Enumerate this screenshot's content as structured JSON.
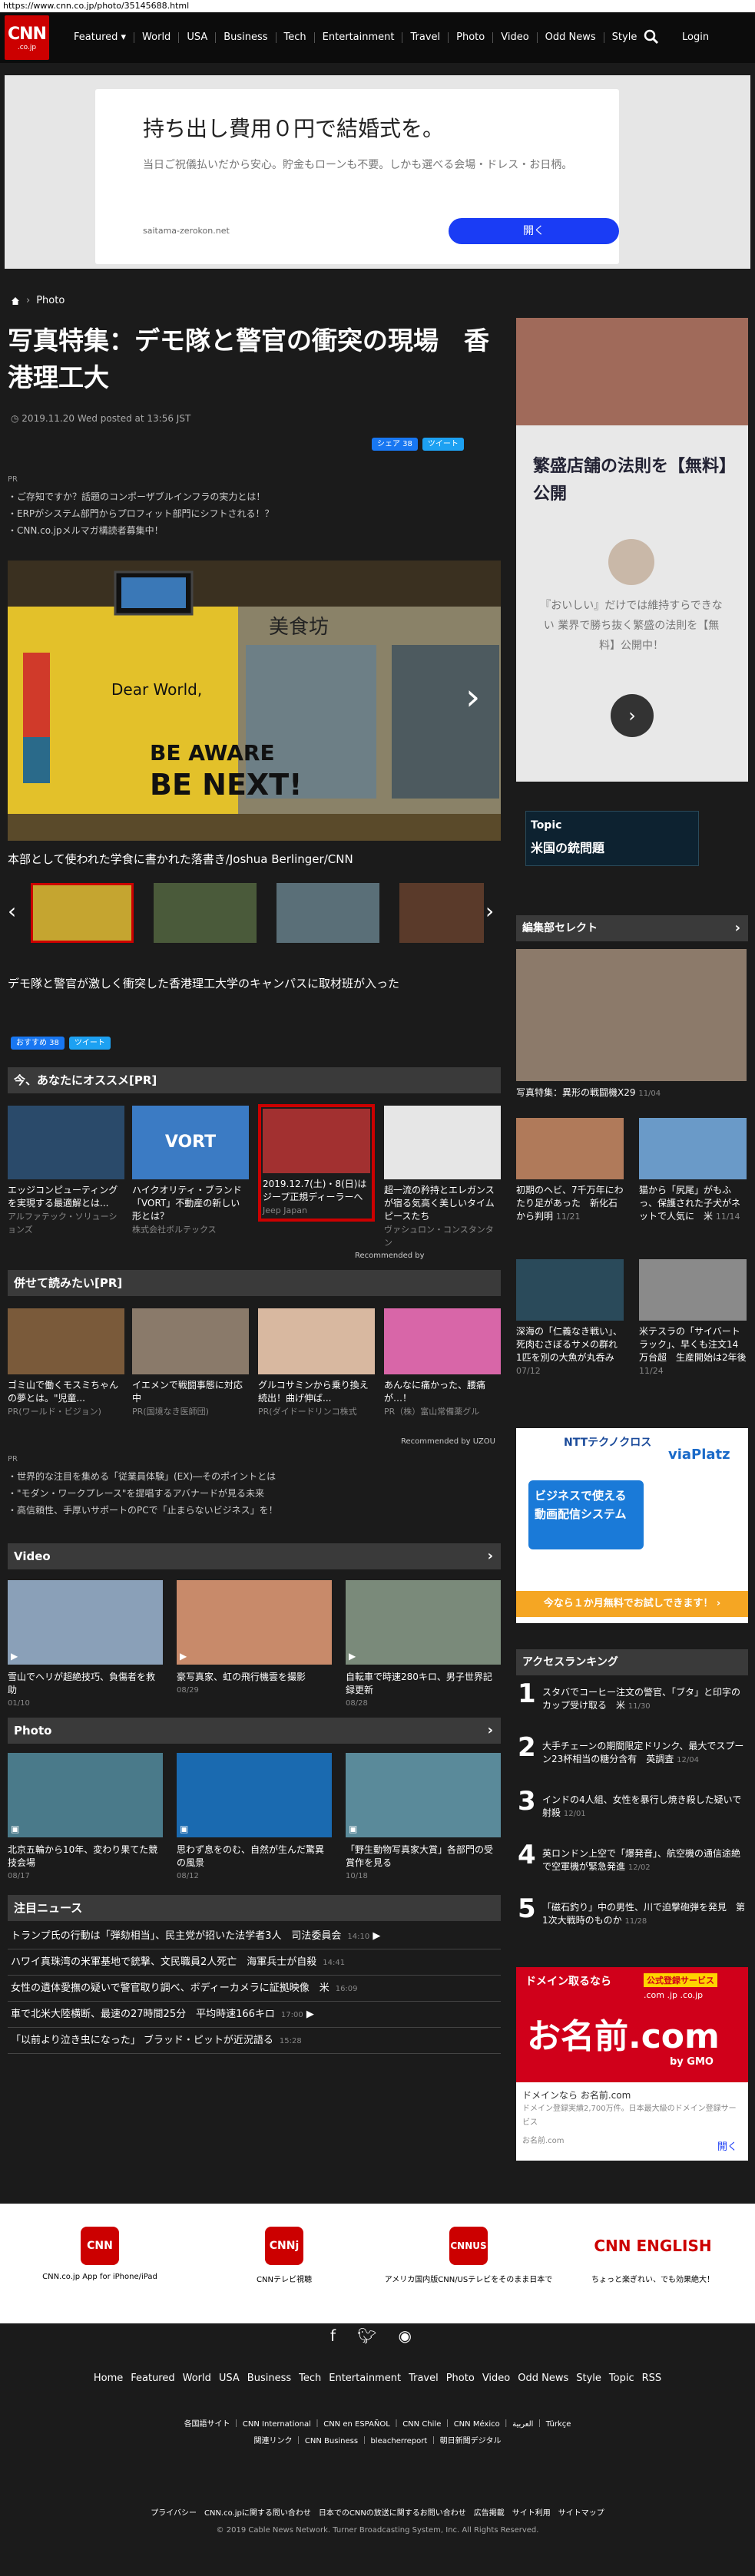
{
  "browser": {
    "url": "https://www.cnn.co.jp/photo/35145688.html"
  },
  "header": {
    "logo_main": "CNN",
    "logo_sub": ".co.jp",
    "nav": [
      "Featured ▾",
      "World",
      "USA",
      "Business",
      "Tech",
      "Entertainment",
      "Travel",
      "Photo",
      "Video",
      "Odd News",
      "Style"
    ],
    "login": "Login"
  },
  "ad_top": {
    "headline": "持ち出し費用０円で結婚式を。",
    "body": "当日ご祝儀払いだから安心。貯金もローンも不要。しかも選べる会場・ドレス・お日柄。",
    "source": "saitama-zerokon.net",
    "button": "開く"
  },
  "breadcrumb": {
    "label": "Photo"
  },
  "article": {
    "title": "写真特集：デモ隊と警官の衝突の現場　香港理工大",
    "date": "2019.11.20 Wed posted at 13:56 JST",
    "share_fb": "シェア 38",
    "share_tw": "ツイート",
    "pr_tag": "PR",
    "pr_items": [
      "・ご存知ですか？話題のコンポーザブルインフラの実力とは！",
      "・ERPがシステム部門からプロフィット部門にシフトされる！？",
      "・CNN.co.jpメルマガ構読者募集中！"
    ],
    "caption": "本部として使われた学食に書かれた落書き/Joshua Berlinger/CNN",
    "description": "デモ隊と警官が激しく衝突した香港理工大学のキャンパスに取材班が入った",
    "graffiti": [
      "Dear World,",
      "BE AWARE",
      "BE NEXT!"
    ],
    "sign": "美食坊",
    "recommend_fb": "おすすめ 38",
    "recommend_tw": "ツイート"
  },
  "recommend": {
    "header": "今、あなたにオススメ[PR]",
    "items": [
      {
        "title": "エッジコンピューティングを実現する最適解とは...",
        "source": "アルファテック・ソリューションズ"
      },
      {
        "title": "ハイクオリティ・ブランド「VORT」不動産の新しい形とは？",
        "source": "株式会社ボルテックス"
      },
      {
        "title": "2019.12.7(土)・8(日)はジープ正規ディーラーへ",
        "source": "Jeep Japan"
      },
      {
        "title": "超一流の矜持とエレガンスが宿る気高く美しいタイムピースたち",
        "source": "ヴァシュロン・コンスタンタン"
      }
    ],
    "recommended_by": "Recommended by",
    "brand": "VORT"
  },
  "also_read": {
    "header": "併せて読みたい[PR]",
    "items": [
      {
        "title": "ゴミ山で働くモスミちゃんの夢とは。\"児童...",
        "source": "PR(ワールド・ビジョン)"
      },
      {
        "title": "イエメンで戦闘事態に対応中",
        "source": "PR(国境なき医師団)"
      },
      {
        "title": "グルコサミンから乗り換え続出！曲げ伸ば...",
        "source": "PR(ダイドードリンコ株式"
      },
      {
        "title": "あんなに痛かった、腰痛が…！",
        "source": "PR（株）富山常備薬グル"
      }
    ],
    "recommended_by": "Recommended by UZOU",
    "pr_tag": "PR",
    "pr_items": [
      "・世界的な注目を集める「従業員体験」(EX)―そのポイントとは",
      "・\"モダン・ワークプレース\"を提唱するアバナードが見る未来",
      "・高信頼性、手厚いサポートのPCで「止まらないビジネス」を！"
    ]
  },
  "video": {
    "header": "Video",
    "items": [
      {
        "title": "雪山でヘリが超絶技巧、負傷者を救助",
        "date": "01/10"
      },
      {
        "title": "豪写真家、虹の飛行機雲を撮影",
        "date": "08/29"
      },
      {
        "title": "自転車で時速280キロ、男子世界記録更新",
        "date": "08/28"
      }
    ]
  },
  "photo": {
    "header": "Photo",
    "items": [
      {
        "title": "北京五輪から10年、変わり果てた競技会場",
        "date": "08/17"
      },
      {
        "title": "思わず息をのむ、自然が生んだ驚異の風景",
        "date": "08/12"
      },
      {
        "title": "「野生動物写真家大賞」各部門の受賞作を見る",
        "date": "10/18"
      }
    ]
  },
  "news": {
    "header": "注目ニュース",
    "items": [
      {
        "title": "トランプ氏の行動は「弾劾相当」、民主党が招いた法学者3人　司法委員会",
        "time": "14:10"
      },
      {
        "title": "ハワイ真珠湾の米軍基地で銃撃、文民職員2人死亡　海軍兵士が自殺",
        "time": "14:41"
      },
      {
        "title": "女性の遺体愛撫の疑いで警官取り調べ、ボディーカメラに証拠映像　米",
        "time": "16:09"
      },
      {
        "title": "車で北米大陸横断、最速の27時間25分　平均時速166キロ",
        "time": "17:00"
      },
      {
        "title": "「以前より泣き虫になった」 ブラッド・ピットが近況語る",
        "time": "15:28"
      }
    ]
  },
  "side_ad1": {
    "headline": "繁盛店舗の法則を【無料】公開",
    "body": "『おいしい』だけでは維持すらできない 業界で勝ち抜く繁盛の法則を【無料】公開中！"
  },
  "topic": {
    "label": "Topic",
    "title": "米国の銃問題"
  },
  "editors": {
    "header": "編集部セレクト",
    "main": {
      "title": "写真特集：異形の戦闘機X29",
      "date": "11/04"
    },
    "items": [
      {
        "title": "初期のヘビ、7千万年にわたり足があった　新化石から判明",
        "date": "11/21"
      },
      {
        "title": "猫から「尻尾」がもふっ、保護された子犬がネットで人気に　米",
        "date": "11/14"
      },
      {
        "title": "深海の「仁義なき戦い」、死肉むさぼるサメの群れ　1匹を別の大魚が丸呑み",
        "date": "07/12"
      },
      {
        "title": "米テスラの「サイバートラック」、早くも注文14万台超　生産開始は2年後",
        "date": "11/24"
      }
    ]
  },
  "side_ad2": {
    "brand": "NTTテクノクロス",
    "product": "viaPlatz",
    "headline": "ビジネスで使える動画配信システム",
    "cta": "今なら１か月無料でお試しできます！ ›"
  },
  "ranking": {
    "header": "アクセスランキング",
    "items": [
      {
        "rank": "1",
        "title": "スタバでコーヒー注文の警官、「ブタ」と印字のカップ受け取る　米",
        "date": "11/30"
      },
      {
        "rank": "2",
        "title": "大手チェーンの期間限定ドリンク、最大でスプーン23杯相当の糖分含有　英調査",
        "date": "12/04"
      },
      {
        "rank": "3",
        "title": "インドの4人組、女性を暴行し焼き殺した疑いで射殺",
        "date": "12/01"
      },
      {
        "rank": "4",
        "title": "英ロンドン上空で「爆発音」、航空機の通信途絶で空軍機が緊急発進",
        "date": "12/02"
      },
      {
        "rank": "5",
        "title": "「磁石釣り」中の男性、川で迫撃砲弾を発見　第1次大戦時のものか",
        "date": "11/28"
      }
    ]
  },
  "side_ad3": {
    "tag": "ドメイン取るなら",
    "badge": "公式登録サービス",
    "brand": "お名前.com",
    "by": "by GMO",
    "tlds": ".com .jp .co.jp",
    "line1": "ドメインなら お名前.com",
    "line2": "ドメイン登録実績2,700万件。日本最大級のドメイン登録サービス",
    "src": "お名前.com",
    "open": "開く"
  },
  "apps": [
    {
      "icon": "CNN",
      "label": "CNN.co.jp App for iPhone/iPad"
    },
    {
      "icon": "CNNj",
      "label": "CNNテレビ視聴"
    },
    {
      "icon": "CNNUS",
      "label": "アメリカ国内版CNN/USテレビをそのまま日本で"
    },
    {
      "icon": "CNN ENGLISH",
      "label": "ちょっと楽ぎれい、でも効果絶大！"
    }
  ],
  "footer": {
    "nav": [
      "Home",
      "Featured",
      "World",
      "USA",
      "Business",
      "Tech",
      "Entertainment",
      "Travel",
      "Photo",
      "Video",
      "Odd News",
      "Style",
      "Topic",
      "RSS"
    ],
    "links1": "各国語サイト ｜ CNN International ｜ CNN en ESPAÑOL ｜ CNN Chile ｜ CNN México ｜ العربية ｜ Türkçe",
    "links2": "関連リンク ｜ CNN Business ｜ bleacherreport ｜ 朝日新聞デジタル",
    "links3": "プライバシー　CNN.co.jpに関する問い合わせ　日本でのCNNの放送に関するお問い合わせ　広告掲載　サイト利用　サイトマップ",
    "copyright": "© 2019 Cable News Network.  Turner Broadcasting System, Inc.  All Rights Reserved."
  },
  "colors": {
    "bg": "#1b1b1b",
    "brand": "#cc0000",
    "accent": "#1a3cf5"
  }
}
